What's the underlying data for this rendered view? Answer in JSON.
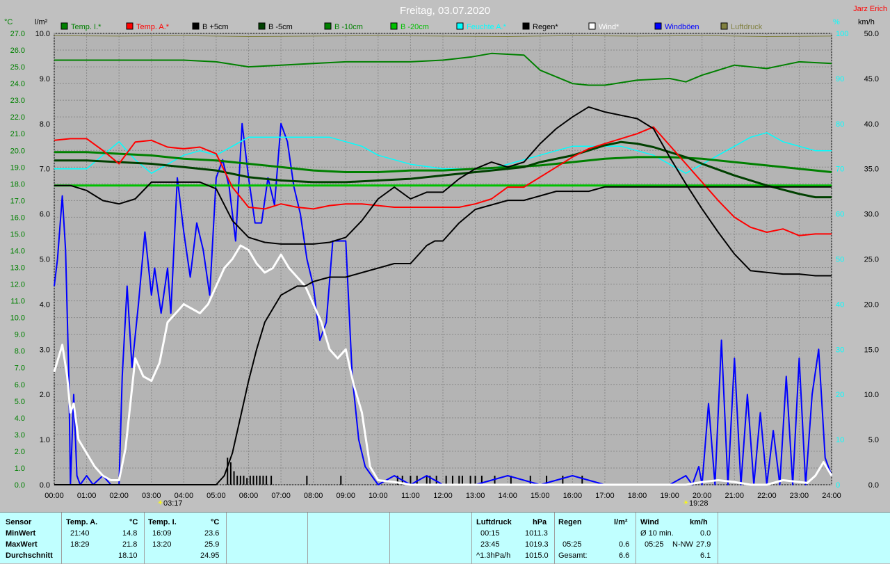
{
  "chart_data": {
    "type": "line",
    "title": "Freitag, 03.07.2020",
    "author": "Jarz Erich",
    "xlim": [
      0,
      24
    ],
    "x_ticks": [
      "00:00",
      "01:00",
      "02:00",
      "03:00",
      "04:00",
      "05:00",
      "06:00",
      "07:00",
      "08:00",
      "09:00",
      "10:00",
      "11:00",
      "12:00",
      "13:00",
      "14:00",
      "15:00",
      "16:00",
      "17:00",
      "18:00",
      "19:00",
      "20:00",
      "21:00",
      "22:00",
      "23:00",
      "24:00"
    ],
    "sunrise_label": "03:17",
    "sunset_label": "19:28",
    "temp_axis": {
      "unit": "°C",
      "min": 0.0,
      "max": 27.0,
      "step": 1.0
    },
    "rain_axis": {
      "unit": "l/m²",
      "min": 0.0,
      "max": 10.0,
      "step": 1.0
    },
    "humidity_axis": {
      "unit": "%",
      "min": 0,
      "max": 100,
      "step": 10
    },
    "wind_axis": {
      "unit": "km/h",
      "min": 0.0,
      "max": 50.0,
      "step": 5.0
    },
    "grid": true,
    "legend": [
      {
        "label": "Temp. I.*",
        "color": "#008000"
      },
      {
        "label": "Temp. A.*",
        "color": "#ff0000"
      },
      {
        "label": "B +5cm",
        "color": "#000000"
      },
      {
        "label": "B -5cm",
        "color": "#004000"
      },
      {
        "label": "B -10cm",
        "color": "#008000"
      },
      {
        "label": "B -20cm",
        "color": "#00c000"
      },
      {
        "label": "Feuchte A.*",
        "color": "#00ffff"
      },
      {
        "label": "Regen*",
        "color": "#000000"
      },
      {
        "label": "Wind*",
        "color": "#ffffff"
      },
      {
        "label": "Windböen",
        "color": "#0000ff"
      },
      {
        "label": "Luftdruck",
        "color": "#808040"
      }
    ],
    "series": [
      {
        "name": "Temp. I.*",
        "axis": "temp",
        "color": "#008000",
        "x": [
          0,
          1,
          2,
          3,
          4,
          5,
          6,
          7,
          8,
          9,
          10,
          11,
          12,
          12.9,
          13.5,
          14.5,
          15,
          16,
          16.5,
          17,
          18,
          19,
          19.5,
          20,
          21,
          22,
          22.5,
          23,
          24
        ],
        "y": [
          25.4,
          25.4,
          25.4,
          25.4,
          25.4,
          25.3,
          25.0,
          25.1,
          25.2,
          25.3,
          25.3,
          25.3,
          25.4,
          25.6,
          25.8,
          25.7,
          24.8,
          24.0,
          23.9,
          23.9,
          24.2,
          24.3,
          24.1,
          24.5,
          25.1,
          24.9,
          25.1,
          25.3,
          25.2
        ]
      },
      {
        "name": "Temp. A.*",
        "axis": "temp",
        "color": "#ff0000",
        "x": [
          0,
          0.5,
          1,
          1.5,
          2,
          2.5,
          3,
          3.5,
          4,
          4.5,
          5,
          5.5,
          6,
          6.5,
          7,
          7.5,
          8,
          8.5,
          9,
          9.5,
          10,
          10.5,
          11,
          12,
          12.5,
          13,
          13.5,
          14,
          14.5,
          15,
          15.5,
          16,
          16.5,
          17,
          17.5,
          18,
          18.5,
          19,
          19.5,
          20,
          20.5,
          21,
          21.5,
          22,
          22.5,
          23,
          23.5,
          24
        ],
        "y": [
          20.6,
          20.7,
          20.7,
          20.0,
          19.2,
          20.5,
          20.6,
          20.2,
          20.1,
          20.2,
          19.8,
          17.8,
          16.6,
          16.5,
          16.8,
          16.6,
          16.5,
          16.7,
          16.8,
          16.8,
          16.7,
          16.6,
          16.6,
          16.6,
          16.6,
          16.8,
          17.1,
          17.8,
          17.8,
          18.4,
          19.0,
          19.6,
          20.1,
          20.4,
          20.7,
          21.0,
          21.4,
          20.3,
          19.2,
          18.1,
          17.0,
          16.0,
          15.4,
          15.1,
          15.3,
          14.9,
          15.0,
          15.0
        ]
      },
      {
        "name": "B +5cm",
        "axis": "temp",
        "color": "#000000",
        "x": [
          0,
          0.5,
          1,
          1.5,
          2,
          2.5,
          3,
          3.5,
          4,
          4.5,
          5,
          5.5,
          6,
          6.5,
          7,
          7.5,
          8,
          8.5,
          9,
          9.5,
          10,
          10.5,
          11,
          11.5,
          12,
          12.5,
          13,
          13.5,
          14,
          14.5,
          15,
          15.5,
          16,
          16.5,
          17,
          17.5,
          18,
          18.5,
          19,
          19.5,
          20,
          20.5,
          21,
          21.5,
          22,
          22.5,
          23,
          23.5,
          24
        ],
        "y": [
          17.9,
          17.9,
          17.6,
          17.0,
          16.8,
          17.1,
          18.1,
          18.1,
          18.1,
          18.1,
          17.7,
          15.8,
          14.8,
          14.5,
          14.4,
          14.4,
          14.4,
          14.5,
          14.8,
          15.8,
          17.1,
          17.8,
          17.1,
          17.5,
          17.5,
          18.3,
          18.9,
          19.3,
          19.0,
          19.3,
          20.4,
          21.3,
          22.0,
          22.6,
          22.3,
          22.1,
          21.9,
          21.3,
          19.6,
          18.0,
          16.5,
          15.1,
          13.8,
          12.8,
          12.7,
          12.6,
          12.6,
          12.5,
          12.5
        ]
      },
      {
        "name": "B -5cm",
        "axis": "temp",
        "color": "#004000",
        "x": [
          0,
          1,
          2,
          3,
          4,
          5,
          6,
          7,
          8,
          9,
          10,
          11,
          12,
          13,
          14,
          14.5,
          15,
          16,
          16.5,
          17,
          17.5,
          18,
          18.5,
          19,
          19.5,
          20,
          21,
          22,
          23,
          23.5,
          24
        ],
        "y": [
          19.4,
          19.4,
          19.3,
          19.2,
          19.0,
          18.8,
          18.4,
          18.2,
          18.1,
          18.1,
          18.2,
          18.3,
          18.5,
          18.7,
          18.9,
          19.0,
          19.3,
          19.7,
          20.0,
          20.3,
          20.5,
          20.4,
          20.2,
          19.9,
          19.6,
          19.2,
          18.5,
          17.9,
          17.4,
          17.2,
          17.2
        ]
      },
      {
        "name": "B -10cm",
        "axis": "temp",
        "color": "#008000",
        "x": [
          0,
          1,
          2,
          3,
          4,
          5,
          6,
          7,
          8,
          9,
          10,
          11,
          12,
          13,
          14,
          15,
          16,
          17,
          18,
          19,
          20,
          21,
          22,
          23,
          24
        ],
        "y": [
          19.9,
          19.9,
          19.8,
          19.7,
          19.5,
          19.4,
          19.2,
          19.0,
          18.8,
          18.7,
          18.7,
          18.8,
          18.8,
          18.9,
          19.0,
          19.1,
          19.3,
          19.5,
          19.6,
          19.6,
          19.5,
          19.3,
          19.1,
          18.9,
          18.7
        ]
      },
      {
        "name": "B -20cm",
        "axis": "temp",
        "color": "#00c000",
        "x": [
          0,
          2,
          4,
          6,
          8,
          10,
          12,
          14,
          16,
          18,
          20,
          22,
          24
        ],
        "y": [
          17.9,
          17.9,
          17.9,
          17.9,
          17.9,
          17.9,
          17.9,
          17.9,
          17.9,
          17.9,
          17.9,
          17.9,
          17.9
        ]
      },
      {
        "name": "Feuchte A.*",
        "axis": "humidity",
        "color": "#00ffff",
        "x": [
          0,
          0.5,
          1,
          1.5,
          2,
          2.5,
          3,
          3.5,
          4,
          4.5,
          5,
          5.5,
          6,
          6.5,
          7,
          7.5,
          8,
          8.5,
          9,
          9.5,
          10,
          10.5,
          11,
          12,
          13,
          13.5,
          14,
          14.5,
          15,
          15.5,
          16,
          16.5,
          17,
          17.5,
          18,
          18.5,
          19,
          19.5,
          20,
          20.5,
          21,
          21.5,
          22,
          22.5,
          23,
          23.5,
          24
        ],
        "y": [
          70,
          70,
          70,
          73,
          76,
          72,
          69,
          71,
          73,
          74,
          73,
          75,
          77,
          77,
          77,
          77,
          77,
          77,
          76,
          75,
          73,
          72,
          71,
          70,
          70,
          70,
          71,
          72,
          73,
          74,
          75,
          75,
          75,
          75,
          74,
          73,
          71,
          69,
          71,
          73,
          75,
          77,
          78,
          76,
          75,
          74,
          74
        ]
      },
      {
        "name": "Wind*",
        "axis": "wind",
        "color": "#ffffff",
        "x": [
          0,
          0.25,
          0.4,
          0.5,
          0.6,
          0.75,
          1,
          1.25,
          1.5,
          1.75,
          2,
          2.2,
          2.5,
          2.75,
          3,
          3.25,
          3.5,
          3.75,
          4,
          4.25,
          4.5,
          4.75,
          5,
          5.25,
          5.5,
          5.75,
          6,
          6.25,
          6.5,
          6.75,
          7,
          7.25,
          7.5,
          7.75,
          8,
          8.25,
          8.5,
          8.75,
          9,
          9.25,
          9.5,
          9.75,
          10,
          10.5,
          11,
          12,
          15,
          18,
          19,
          19.5,
          20,
          20.5,
          21,
          21.5,
          22,
          22.5,
          23,
          23.25,
          23.5,
          23.75,
          24
        ],
        "y": [
          12.5,
          15.5,
          12.0,
          8.0,
          9.0,
          5.0,
          3.5,
          2.0,
          1.0,
          0.5,
          0.5,
          4.0,
          14.0,
          12.0,
          11.5,
          13.5,
          18.0,
          19.0,
          20.0,
          19.5,
          19.0,
          20.0,
          22.0,
          24.0,
          25.0,
          26.5,
          26.0,
          24.5,
          23.5,
          24.0,
          25.5,
          24.0,
          23.0,
          22.0,
          20.0,
          18.0,
          15.0,
          14.0,
          15.0,
          11.0,
          8.0,
          2.0,
          0.5,
          0.3,
          0,
          0,
          0,
          0,
          0,
          0,
          0.3,
          0.5,
          0.3,
          0,
          0,
          0.5,
          0.3,
          0.2,
          1.0,
          2.5,
          1.0
        ]
      },
      {
        "name": "Windböen",
        "axis": "wind",
        "color": "#0000ff",
        "x": [
          0,
          0.1,
          0.25,
          0.35,
          0.45,
          0.5,
          0.6,
          0.7,
          0.8,
          1,
          1.2,
          1.5,
          1.75,
          2,
          2.1,
          2.25,
          2.4,
          2.6,
          2.8,
          3,
          3.1,
          3.3,
          3.5,
          3.6,
          3.8,
          4,
          4.2,
          4.4,
          4.6,
          4.8,
          5,
          5.2,
          5.4,
          5.6,
          5.8,
          6,
          6.2,
          6.4,
          6.6,
          6.8,
          7,
          7.2,
          7.4,
          7.6,
          7.8,
          8,
          8.2,
          8.4,
          8.6,
          8.8,
          9,
          9.2,
          9.4,
          9.6,
          9.8,
          10,
          10.5,
          11,
          11.5,
          12,
          13,
          14,
          15,
          16,
          17,
          18,
          19,
          19.5,
          19.7,
          19.9,
          20,
          20.2,
          20.4,
          20.6,
          20.8,
          21,
          21.2,
          21.4,
          21.6,
          21.8,
          22,
          22.2,
          22.4,
          22.6,
          22.8,
          23,
          23.2,
          23.4,
          23.6,
          23.8,
          24
        ],
        "y": [
          22,
          25,
          32,
          26,
          12,
          0,
          10,
          1,
          0,
          1,
          0,
          1,
          0,
          0,
          12,
          22,
          13,
          20,
          28,
          21,
          24,
          19,
          24,
          19,
          34,
          28,
          23,
          29,
          26,
          21,
          34,
          36,
          33,
          27,
          40,
          34,
          29,
          29,
          34,
          31,
          40,
          38,
          33,
          30,
          25,
          22,
          16,
          18,
          27,
          27,
          27,
          12,
          5,
          2,
          1,
          0,
          1,
          0,
          1,
          0,
          0,
          1,
          0,
          1,
          0,
          0,
          0,
          1,
          0,
          2,
          0,
          9,
          0,
          16,
          0,
          14,
          0,
          10,
          0,
          8,
          0,
          6,
          0,
          12,
          0,
          14,
          0,
          10,
          15,
          3,
          1
        ]
      },
      {
        "name": "Luftdruck",
        "axis": "humidity",
        "color": "#808040",
        "x": [
          0,
          2,
          4,
          6,
          8,
          10,
          12,
          14,
          16,
          18,
          20,
          22,
          24
        ],
        "y": [
          99.5,
          99.4,
          99.5,
          99.3,
          99.4,
          99.5,
          99.4,
          99.3,
          99.5,
          99.4,
          99.5,
          99.3,
          99.4
        ]
      }
    ],
    "rain_cumulative": {
      "name": "Regen*",
      "axis": "rain",
      "color": "#000000",
      "x": [
        0,
        5,
        5.25,
        5.5,
        5.75,
        6,
        6.25,
        6.5,
        6.75,
        7,
        7.25,
        7.5,
        7.75,
        8,
        8.5,
        9,
        9.5,
        10,
        10.5,
        11,
        11.25,
        11.5,
        11.75,
        12,
        12.5,
        13,
        13.5,
        14,
        14.5,
        15,
        15.5,
        16,
        16.5,
        17,
        18,
        19,
        20,
        21,
        22,
        23,
        24
      ],
      "y": [
        0,
        0,
        0.2,
        0.7,
        1.5,
        2.3,
        3.0,
        3.6,
        3.9,
        4.2,
        4.3,
        4.4,
        4.4,
        4.5,
        4.6,
        4.6,
        4.7,
        4.8,
        4.9,
        4.9,
        5.1,
        5.3,
        5.4,
        5.4,
        5.8,
        6.1,
        6.2,
        6.3,
        6.3,
        6.4,
        6.5,
        6.5,
        6.5,
        6.6,
        6.6,
        6.6,
        6.6,
        6.6,
        6.6,
        6.6,
        6.6
      ]
    },
    "rain_events": {
      "axis": "rain",
      "x": [
        5.35,
        5.45,
        5.55,
        5.65,
        5.75,
        5.85,
        5.95,
        6.05,
        6.15,
        6.25,
        6.35,
        6.45,
        6.55,
        6.7,
        7.8,
        8.85,
        10.6,
        10.75,
        11.0,
        11.2,
        11.5,
        11.6,
        11.8,
        12.1,
        12.3,
        12.5,
        12.6,
        12.85,
        13.0,
        13.2,
        13.6,
        14.1,
        14.7,
        15.2,
        15.7,
        16.3
      ],
      "y": [
        0.6,
        0.5,
        0.3,
        0.2,
        0.2,
        0.2,
        0.15,
        0.2,
        0.2,
        0.2,
        0.2,
        0.2,
        0.2,
        0.2,
        0.2,
        0.2,
        0.2,
        0.2,
        0.2,
        0.2,
        0.2,
        0.2,
        0.2,
        0.2,
        0.2,
        0.2,
        0.2,
        0.2,
        0.2,
        0.2,
        0.2,
        0.2,
        0.2,
        0.2,
        0.2,
        0.2
      ]
    }
  },
  "table": {
    "sensor_header": "Sensor",
    "row_labels": [
      "MinWert",
      "MaxWert",
      "Durchschnitt"
    ],
    "temp_a": {
      "header": "Temp. A.",
      "unit": "°C",
      "min_time": "21:40",
      "min": "14.8",
      "max_time": "18:29",
      "max": "21.8",
      "avg": "18.10"
    },
    "temp_i": {
      "header": "Temp. I.",
      "unit": "°C",
      "min_time": "16:09",
      "min": "23.6",
      "max_time": "13:20",
      "max": "25.9",
      "avg": "24.95"
    },
    "pressure": {
      "header": "Luftdruck",
      "unit": "hPa",
      "min_time": "00:15",
      "min": "1011.3",
      "max_time": "23:45",
      "max": "1019.3",
      "trend_label": "^1.3hPa/h",
      "trend": "1015.0"
    },
    "rain": {
      "header": "Regen",
      "unit": "l/m²",
      "max_time": "05:25",
      "max": "0.6",
      "total_label": "Gesamt:",
      "total": "6.6"
    },
    "wind": {
      "header": "Wind",
      "unit": "km/h",
      "avg10_label": "Ø 10 min.",
      "avg10": "0.0",
      "max_time": "05:25",
      "max_dir": "N-NW",
      "max": "27.9",
      "avg": "6.1"
    }
  }
}
